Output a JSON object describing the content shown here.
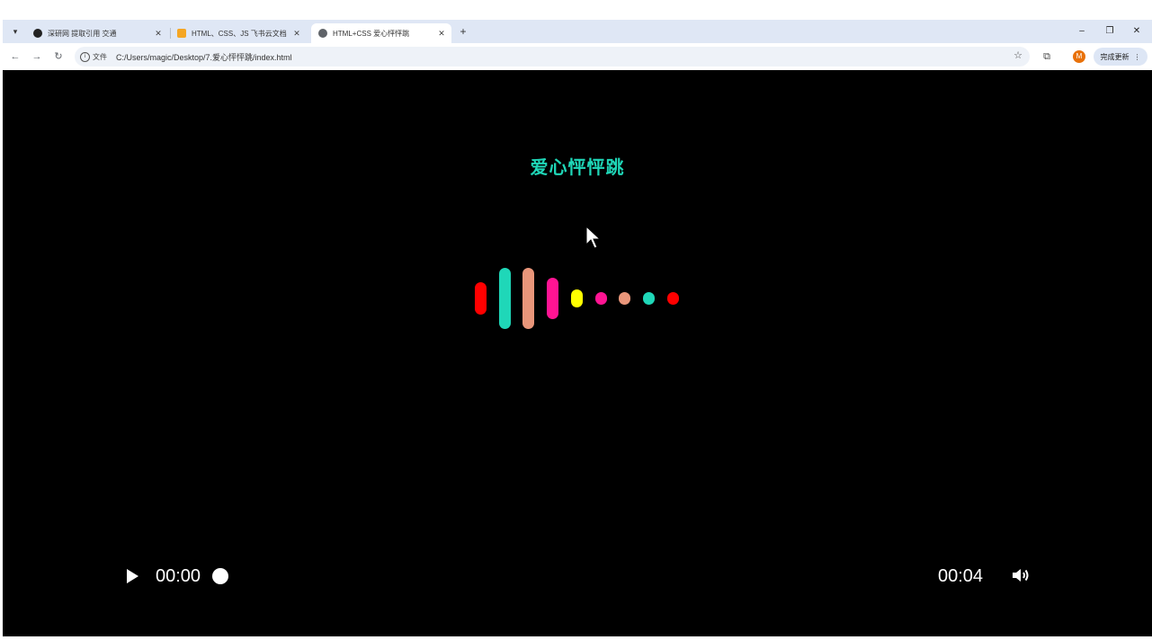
{
  "browser": {
    "tabs": [
      {
        "title": "深研网 提取引用 交通",
        "favicon_color": "#222222"
      },
      {
        "title": "HTML、CSS、JS 飞书云文档",
        "favicon_color": "#f5a623"
      },
      {
        "title": "HTML+CSS 爱心怦怦跳",
        "favicon_color": "#5f6368"
      }
    ],
    "active_tab": 2,
    "site_info_label": "文件",
    "url": "C:/Users/magic/Desktop/7.爱心怦怦跳/index.html",
    "avatar_letter": "M",
    "update_label": "完成更新"
  },
  "page": {
    "title": "爱心怦怦跳"
  },
  "heart_bars": [
    {
      "color": "#ff0000",
      "level": 0.52
    },
    {
      "color": "#1fd7b8",
      "level": 1.0
    },
    {
      "color": "#e9967a",
      "level": 1.0
    },
    {
      "color": "#ff1493",
      "level": 0.68
    },
    {
      "color": "#ffff00",
      "level": 0.3
    },
    {
      "color": "#ff1493",
      "level": 0.2
    },
    {
      "color": "#e9967a",
      "level": 0.2
    },
    {
      "color": "#1fd7b8",
      "level": 0.2
    },
    {
      "color": "#ff0000",
      "level": 0.2
    }
  ],
  "player": {
    "current_time": "00:00",
    "duration": "00:04",
    "progress": 0
  }
}
